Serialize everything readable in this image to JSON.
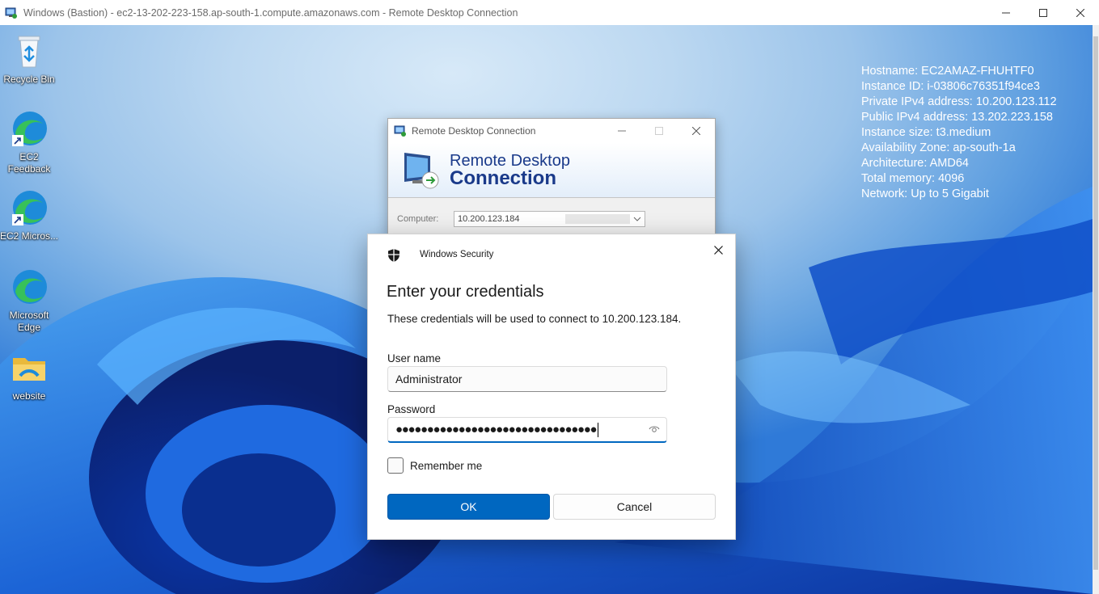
{
  "window": {
    "title": "Windows (Bastion) - ec2-13-202-223-158.ap-south-1.compute.amazonaws.com - Remote Desktop Connection"
  },
  "desktop_icons": [
    {
      "label": "Recycle Bin",
      "icon": "recycle-bin-icon"
    },
    {
      "label": "EC2 Feedback",
      "icon": "edge-shortcut-icon"
    },
    {
      "label": "EC2 Micros...",
      "icon": "edge-shortcut-icon"
    },
    {
      "label": "Microsoft Edge",
      "icon": "edge-icon"
    },
    {
      "label": "website",
      "icon": "folder-icon"
    }
  ],
  "instance_info": [
    "Hostname: EC2AMAZ-FHUHTF0",
    "Instance ID: i-03806c76351f94ce3",
    "Private IPv4 address: 10.200.123.112",
    "Public IPv4 address: 13.202.223.158",
    "Instance size: t3.medium",
    "Availability Zone: ap-south-1a",
    "Architecture: AMD64",
    "Total memory: 4096",
    "Network: Up to 5 Gigabit"
  ],
  "rdc": {
    "title": "Remote Desktop Connection",
    "banner_line1": "Remote Desktop",
    "banner_line2": "Connection",
    "computer_label": "Computer:",
    "computer_value": "10.200.123.184"
  },
  "security": {
    "title": "Windows Security",
    "heading": "Enter your credentials",
    "description": "These credentials will be used to connect to 10.200.123.184.",
    "username_label": "User name",
    "username_value": "Administrator",
    "password_label": "Password",
    "password_mask": "●●●●●●●●●●●●●●●●●●●●●●●●●●●●●●●●",
    "remember_label": "Remember me",
    "remember_checked": false,
    "ok_label": "OK",
    "cancel_label": "Cancel"
  },
  "colors": {
    "accent": "#0067c0",
    "rdc_title_text": "#1a3a8a"
  }
}
